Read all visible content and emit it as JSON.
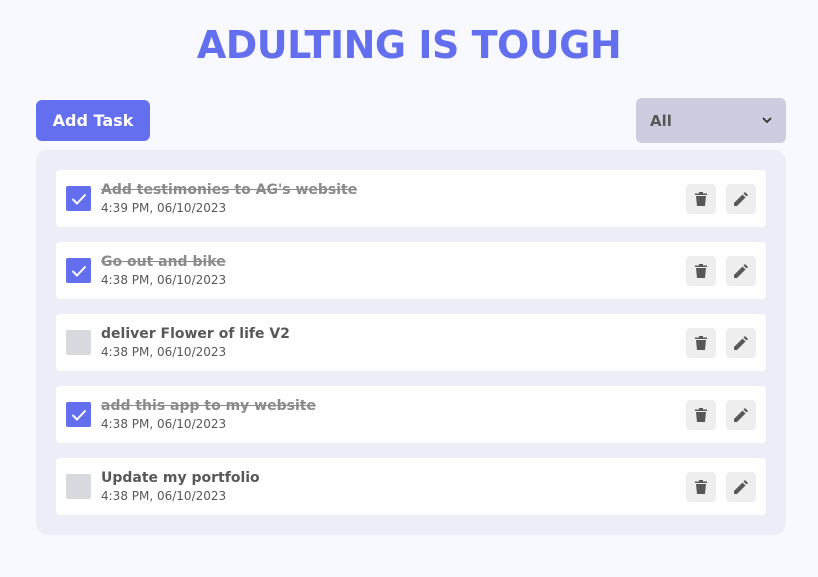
{
  "app": {
    "title": "ADULTING IS TOUGH"
  },
  "toolbar": {
    "add_label": "Add Task",
    "filter_value": "All"
  },
  "tasks": [
    {
      "title": "Add testimonies to AG's website",
      "time": "4:39 PM, 06/10/2023",
      "completed": true
    },
    {
      "title": "Go out and bike",
      "time": "4:38 PM, 06/10/2023",
      "completed": true
    },
    {
      "title": "deliver Flower of life V2",
      "time": "4:38 PM, 06/10/2023",
      "completed": false
    },
    {
      "title": "add this app to my website",
      "time": "4:38 PM, 06/10/2023",
      "completed": true
    },
    {
      "title": "Update my portfolio",
      "time": "4:38 PM, 06/10/2023",
      "completed": false
    }
  ],
  "icons": {
    "delete": "trash-icon",
    "edit": "pencil-icon",
    "check": "check-icon",
    "dropdown": "chevron-down-icon"
  },
  "colors": {
    "accent": "#646ff0",
    "background": "#f8f8ff",
    "panel": "#ecedf6",
    "select": "#cccdde",
    "text": "#585858"
  }
}
